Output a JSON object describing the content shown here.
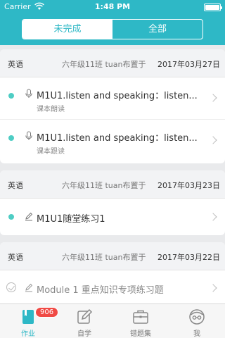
{
  "status_bar": {
    "carrier": "Carrier",
    "time": "1:48 PM"
  },
  "segmented": {
    "tabs": [
      "未完成",
      "全部"
    ],
    "active": 0
  },
  "groups": [
    {
      "subject": "英语",
      "assigner": "六年级11班 tuan布置于",
      "date": "2017年03月27日",
      "items": [
        {
          "title": "M1U1.listen and speaking：listen...",
          "subtitle": "课本朗读",
          "icon": "microphone-icon",
          "status": "unfinished"
        },
        {
          "title": "M1U1.listen and speaking：listen...",
          "subtitle": "课本跟读",
          "icon": "microphone-icon",
          "status": "unfinished"
        }
      ]
    },
    {
      "subject": "英语",
      "assigner": "六年级11班 tuan布置于",
      "date": "2017年03月23日",
      "items": [
        {
          "title": "M1U1随堂练习1",
          "subtitle": "",
          "icon": "write-icon",
          "status": "unfinished"
        }
      ]
    },
    {
      "subject": "英语",
      "assigner": "六年级11班 tuan布置于",
      "date": "2017年03月22日",
      "items": [
        {
          "title": "Module 1 重点知识专项练习题",
          "subtitle": "",
          "icon": "write-icon",
          "status": "done"
        }
      ]
    }
  ],
  "tab_bar": {
    "items": [
      {
        "label": "作业",
        "icon": "homework-book-icon",
        "badge": "906"
      },
      {
        "label": "自学",
        "icon": "self-study-pencil-icon"
      },
      {
        "label": "错题集",
        "icon": "mistakes-briefcase-icon"
      },
      {
        "label": "我",
        "icon": "profile-avatar-icon"
      }
    ],
    "active": 0
  },
  "colors": {
    "accent": "#2eb8c6",
    "dot": "#4ecdc4",
    "badge": "#f04a45"
  }
}
